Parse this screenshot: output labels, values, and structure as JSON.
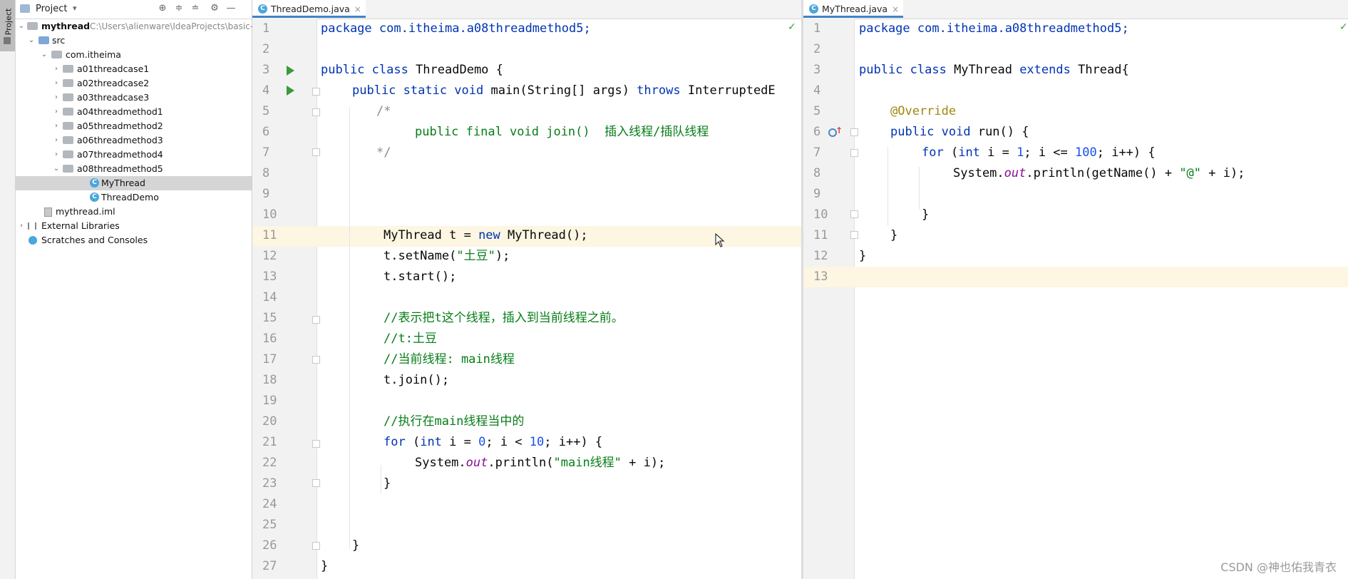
{
  "project_panel": {
    "title": "Project",
    "root_name": "mythread",
    "root_path": "C:\\Users\\alienware\\IdeaProjects\\basic-",
    "tree": [
      {
        "label": "src",
        "kind": "folder-blue"
      },
      {
        "label": "com.itheima",
        "kind": "package"
      },
      {
        "label": "a01threadcase1",
        "kind": "package"
      },
      {
        "label": "a02threadcase2",
        "kind": "package"
      },
      {
        "label": "a03threadcase3",
        "kind": "package"
      },
      {
        "label": "a04threadmethod1",
        "kind": "package"
      },
      {
        "label": "a05threadmethod2",
        "kind": "package"
      },
      {
        "label": "a06threadmethod3",
        "kind": "package"
      },
      {
        "label": "a07threadmethod4",
        "kind": "package"
      },
      {
        "label": "a08threadmethod5",
        "kind": "package"
      },
      {
        "label": "MyThread",
        "kind": "class",
        "selected": true
      },
      {
        "label": "ThreadDemo",
        "kind": "class"
      },
      {
        "label": "mythread.iml",
        "kind": "file"
      },
      {
        "label": "External Libraries",
        "kind": "library"
      },
      {
        "label": "Scratches and Consoles",
        "kind": "scratch"
      }
    ]
  },
  "tool_strip": {
    "label": "Project"
  },
  "left_editor": {
    "tab": "ThreadDemo.java",
    "lines": [
      "1",
      "2",
      "3",
      "4",
      "5",
      "6",
      "7",
      "8",
      "9",
      "10",
      "11",
      "12",
      "13",
      "14",
      "15",
      "16",
      "17",
      "18",
      "19",
      "20",
      "21",
      "22",
      "23",
      "24",
      "25",
      "26",
      "27"
    ],
    "code": {
      "l1": "package com.itheima.a08threadmethod5;",
      "l3_kw": "public class",
      "l3_rest": " ThreadDemo {",
      "l4_kw1": "public static void",
      "l4_mid": " main(String[] args) ",
      "l4_kw2": "throws",
      "l4_rest": " InterruptedE",
      "l5": "/*",
      "l6": "public final void join()  插入线程/插队线程",
      "l7": "*/",
      "l11_a": "MyThread t = ",
      "l11_kw": "new",
      "l11_b": " MyThread();",
      "l12_a": "t.setName(",
      "l12_str": "\"土豆\"",
      "l12_b": ");",
      "l13": "t.start();",
      "l15": "//表示把t这个线程，插入到当前线程之前。",
      "l16": "//t:土豆",
      "l17": "//当前线程: main线程",
      "l18": "t.join();",
      "l20": "//执行在main线程当中的",
      "l21_kw1": "for",
      "l21_a": " (",
      "l21_kw2": "int",
      "l21_b": " i = ",
      "l21_n1": "0",
      "l21_c": "; i < ",
      "l21_n2": "10",
      "l21_d": "; i++) {",
      "l22_a": "System.",
      "l22_out": "out",
      "l22_b": ".println(",
      "l22_str": "\"main线程\"",
      "l22_c": " + i);",
      "l23": "}",
      "l26": "}",
      "l27": "}"
    }
  },
  "right_editor": {
    "tab": "MyThread.java",
    "lines": [
      "1",
      "2",
      "3",
      "4",
      "5",
      "6",
      "7",
      "8",
      "9",
      "10",
      "11",
      "12",
      "13"
    ],
    "code": {
      "l1": "package com.itheima.a08threadmethod5;",
      "l3_kw": "public class",
      "l3_a": " MyThread ",
      "l3_kw2": "extends",
      "l3_b": " Thread{",
      "l5": "@Override",
      "l6_kw": "public void",
      "l6_rest": " run() {",
      "l7_kw1": "for",
      "l7_a": " (",
      "l7_kw2": "int",
      "l7_b": " i = ",
      "l7_n1": "1",
      "l7_c": "; i <= ",
      "l7_n2": "100",
      "l7_d": "; i++) {",
      "l8_a": "System.",
      "l8_out": "out",
      "l8_b": ".println(getName() + ",
      "l8_str": "\"@\"",
      "l8_c": " + i);",
      "l10": "}",
      "l11": "}",
      "l12": "}"
    }
  },
  "watermark": "CSDN @神也佑我青衣",
  "colors": {
    "accent": "#4083c9",
    "keyword": "#0033b3",
    "string": "#067d17",
    "number": "#1750eb"
  }
}
